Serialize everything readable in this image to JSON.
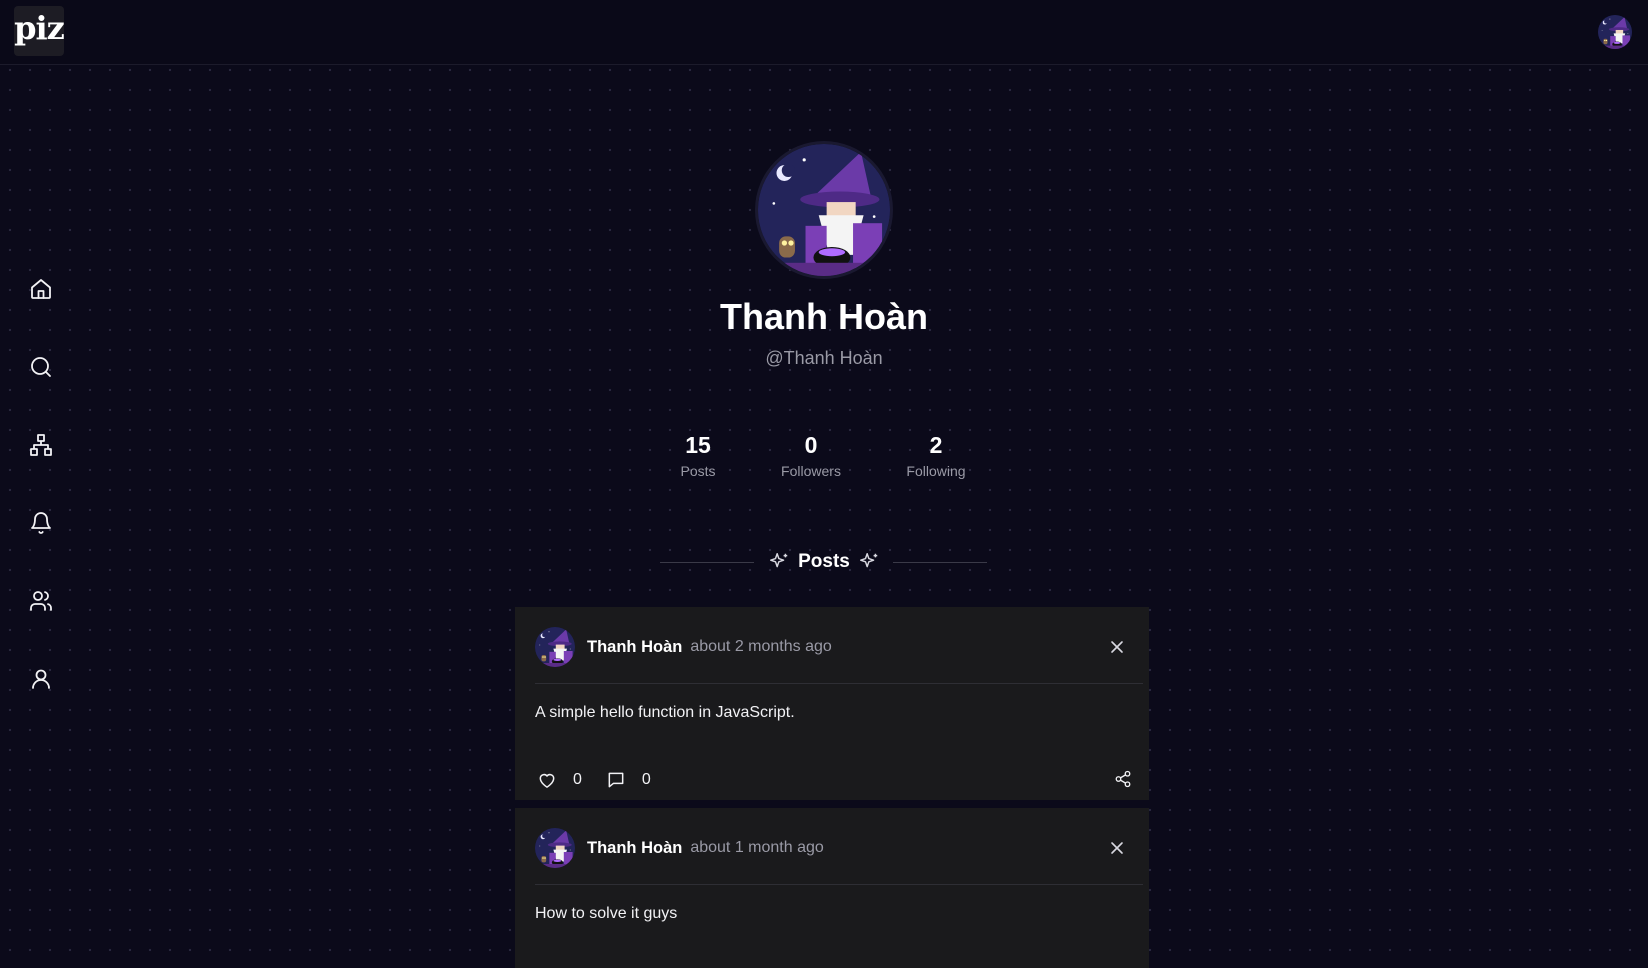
{
  "header": {
    "logo_text": "piz"
  },
  "sidebar": {
    "items": [
      {
        "name": "home",
        "icon": "home-icon"
      },
      {
        "name": "search",
        "icon": "search-icon"
      },
      {
        "name": "network",
        "icon": "network-icon"
      },
      {
        "name": "notifications",
        "icon": "bell-icon"
      },
      {
        "name": "friends",
        "icon": "users-icon"
      },
      {
        "name": "profile",
        "icon": "user-icon"
      }
    ]
  },
  "profile": {
    "display_name": "Thanh Hoàn",
    "handle": "@Thanh Hoàn",
    "stats": [
      {
        "value": "15",
        "label": "Posts"
      },
      {
        "value": "0",
        "label": "Followers"
      },
      {
        "value": "2",
        "label": "Following"
      }
    ]
  },
  "posts_section": {
    "title": "Posts"
  },
  "posts": [
    {
      "author": "Thanh Hoàn",
      "time": "about 2 months ago",
      "content": "A simple hello function in JavaScript.",
      "likes": "0",
      "comments": "0"
    },
    {
      "author": "Thanh Hoàn",
      "time": "about 1 month ago",
      "content": "How to solve it guys"
    }
  ],
  "colors": {
    "background": "#0b0a1a",
    "card": "#1a1a1c",
    "muted_text": "#9a9aa6"
  }
}
